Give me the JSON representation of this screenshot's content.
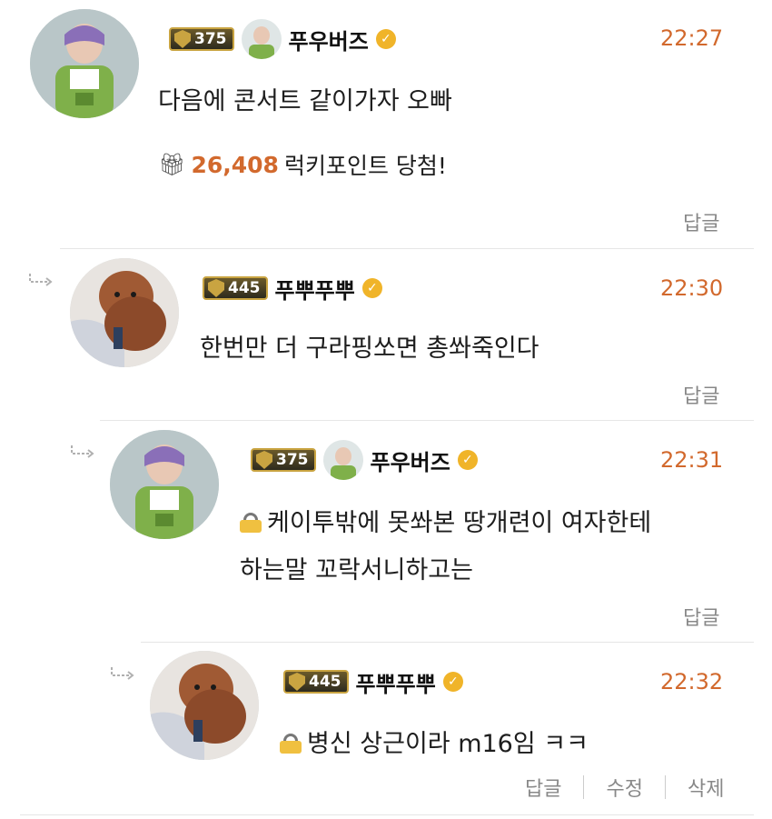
{
  "colors": {
    "accent": "#d2692d",
    "badge_gold": "#c9a441",
    "verified": "#f0b429"
  },
  "comments": [
    {
      "avatar_icon": "buzz-lightyear-avatar",
      "level": "375",
      "has_mini_avatar": true,
      "username": "푸우버즈",
      "time": "22:27",
      "text_lines": [
        "다음에 콘서트 같이가자 오빠"
      ],
      "locked": false,
      "points_icon": "gift-icon",
      "points_value": "26,408",
      "points_label": "럭키포인트 당첨!",
      "actions": [
        "답글"
      ]
    },
    {
      "avatar_icon": "poodle-avatar",
      "level": "445",
      "has_mini_avatar": false,
      "username": "푸뿌푸뿌",
      "time": "22:30",
      "text_lines": [
        "한번만 더 구라핑쏘면 총쏴죽인다"
      ],
      "locked": false,
      "actions": [
        "답글"
      ]
    },
    {
      "avatar_icon": "buzz-lightyear-avatar",
      "level": "375",
      "has_mini_avatar": true,
      "username": "푸우버즈",
      "time": "22:31",
      "text_lines": [
        "케이투밖에 못쏴본 땅개련이 여자한테",
        "하는말 꼬락서니하고는"
      ],
      "locked": true,
      "actions": [
        "답글"
      ]
    },
    {
      "avatar_icon": "poodle-avatar",
      "level": "445",
      "has_mini_avatar": false,
      "username": "푸뿌푸뿌",
      "time": "22:32",
      "text_lines": [
        "병신 상근이라 m16임 ㅋㅋ"
      ],
      "locked": true,
      "actions": [
        "답글",
        "수정",
        "삭제"
      ]
    }
  ]
}
